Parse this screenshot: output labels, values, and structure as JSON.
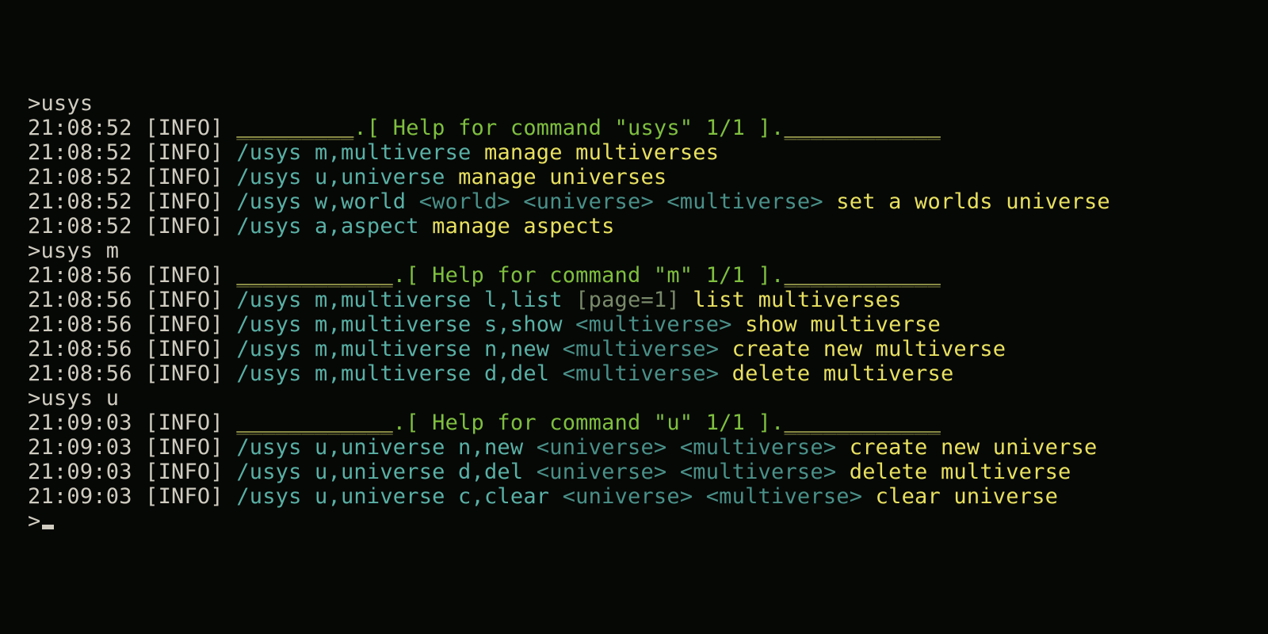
{
  "prompt_char": ">",
  "info_tag": "[INFO]",
  "blocks": [
    {
      "cmd_typed": "usys",
      "ts": "21:08:52",
      "header_pre": "_________",
      "header_mid": ".[ Help for command \"usys\" 1/1 ].",
      "header_post": "____________",
      "rows": [
        {
          "cmd": "/usys m,multiverse",
          "args": "",
          "opt": "",
          "desc": "manage multiverses"
        },
        {
          "cmd": "/usys u,universe",
          "args": "",
          "opt": "",
          "desc": "manage universes"
        },
        {
          "cmd": "/usys w,world",
          "args": "<world> <universe> <multiverse>",
          "opt": "",
          "desc": "set a worlds universe"
        },
        {
          "cmd": "/usys a,aspect",
          "args": "",
          "opt": "",
          "desc": "manage aspects"
        }
      ]
    },
    {
      "cmd_typed": "usys m",
      "ts": "21:08:56",
      "header_pre": "____________",
      "header_mid": ".[ Help for command \"m\" 1/1 ].",
      "header_post": "____________",
      "rows": [
        {
          "cmd": "/usys m,multiverse l,list",
          "args": "",
          "opt": "[page=1]",
          "desc": "list multiverses"
        },
        {
          "cmd": "/usys m,multiverse s,show",
          "args": "<multiverse>",
          "opt": "",
          "desc": "show multiverse"
        },
        {
          "cmd": "/usys m,multiverse n,new",
          "args": "<multiverse>",
          "opt": "",
          "desc": "create new multiverse"
        },
        {
          "cmd": "/usys m,multiverse d,del",
          "args": "<multiverse>",
          "opt": "",
          "desc": "delete multiverse"
        }
      ]
    },
    {
      "cmd_typed": "usys u",
      "ts": "21:09:03",
      "header_pre": "____________",
      "header_mid": ".[ Help for command \"u\" 1/1 ].",
      "header_post": "____________",
      "rows": [
        {
          "cmd": "/usys u,universe n,new",
          "args": "<universe> <multiverse>",
          "opt": "",
          "desc": "create new universe"
        },
        {
          "cmd": "/usys u,universe d,del",
          "args": "<universe> <multiverse>",
          "opt": "",
          "desc": "delete multiverse"
        },
        {
          "cmd": "/usys u,universe c,clear",
          "args": "<universe> <multiverse>",
          "opt": "",
          "desc": "clear universe"
        }
      ]
    }
  ]
}
